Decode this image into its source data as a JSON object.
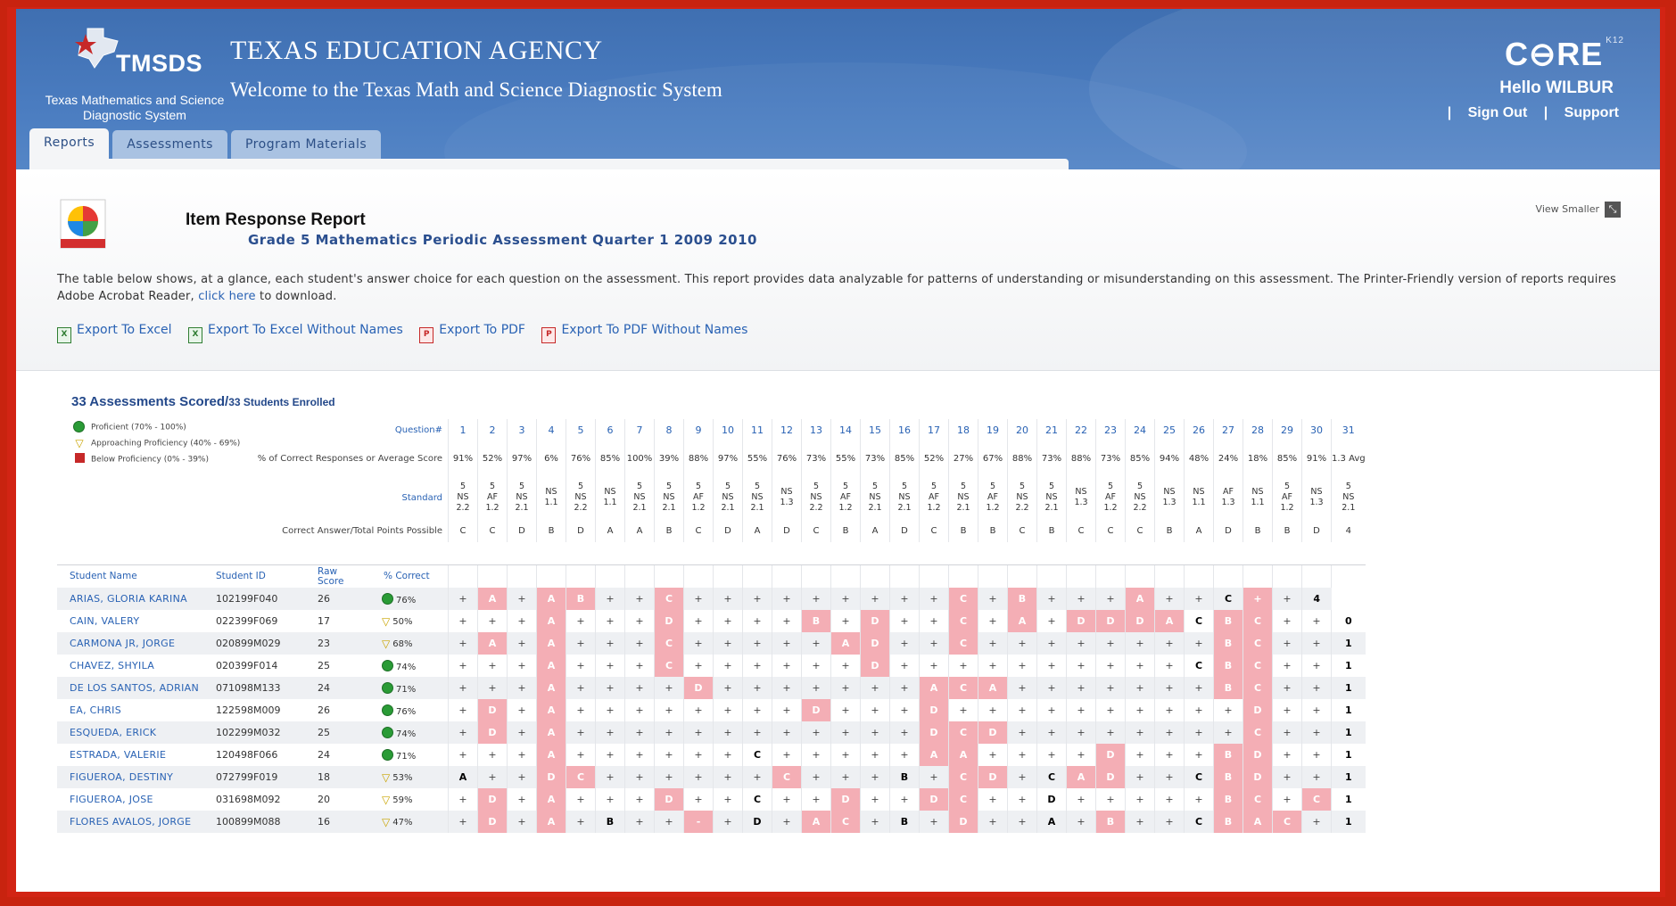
{
  "header": {
    "logo_text": "TMSDS",
    "logo_subtitle": "Texas Mathematics and Science Diagnostic System",
    "agency": "TEXAS EDUCATION AGENCY",
    "welcome": "Welcome to the Texas Math and Science Diagnostic System",
    "brand": "C⊖RE",
    "brand_sup": "K12",
    "hello": "Hello WILBUR",
    "sign_out": "Sign Out",
    "support": "Support",
    "sep": "|"
  },
  "tabs": [
    "Reports",
    "Assessments",
    "Program Materials"
  ],
  "report": {
    "title": "Item Response Report",
    "subtitle": "Grade 5 Mathematics Periodic Assessment Quarter 1 2009 2010",
    "view_smaller": "View Smaller",
    "desc_before": "The table below shows, at a glance, each student's answer choice for each question on the assessment. This report provides data analyzable for patterns of understanding or misunderstanding on this assessment. The Printer-Friendly version of reports requires Adobe Acrobat Reader, ",
    "desc_link": "click here",
    "desc_after": " to download."
  },
  "exports": [
    "Export To Excel",
    "Export To Excel Without Names",
    "Export To PDF",
    "Export To PDF Without Names"
  ],
  "summary": {
    "scored": "33 Assessments Scored/",
    "enrolled": "33 Students Enrolled"
  },
  "legend": [
    {
      "label": "Proficient  (70% - 100%)",
      "color": "#2a9b36"
    },
    {
      "label": "Approaching Proficiency  (40% - 69%)",
      "color": "#c9a400"
    },
    {
      "label": "Below Proficiency  (0% - 39%)",
      "color": "#c62828"
    }
  ],
  "row_labels": {
    "question": "Question#",
    "pct_correct": "% of Correct Responses or Average Score",
    "standard": "Standard",
    "answer": "Correct Answer/Total Points Possible"
  },
  "columns": {
    "student_name": "Student Name",
    "student_id": "Student ID",
    "raw_score": "Raw Score",
    "pct_correct": "% Correct"
  },
  "questions": [
    "1",
    "2",
    "3",
    "4",
    "5",
    "6",
    "7",
    "8",
    "9",
    "10",
    "11",
    "12",
    "13",
    "14",
    "15",
    "16",
    "17",
    "18",
    "19",
    "20",
    "21",
    "22",
    "23",
    "24",
    "25",
    "26",
    "27",
    "28",
    "29",
    "30",
    "31"
  ],
  "pct": [
    "91%",
    "52%",
    "97%",
    "6%",
    "76%",
    "85%",
    "100%",
    "39%",
    "88%",
    "97%",
    "55%",
    "76%",
    "73%",
    "55%",
    "73%",
    "85%",
    "52%",
    "27%",
    "67%",
    "88%",
    "73%",
    "88%",
    "73%",
    "85%",
    "94%",
    "48%",
    "24%",
    "18%",
    "85%",
    "91%",
    "1.3 Avg"
  ],
  "standards": [
    "5 NS 2.2",
    "5 AF 1.2",
    "5 NS 2.1",
    "NS 1.1",
    "5 NS 2.2",
    "NS 1.1",
    "5 NS 2.1",
    "5 NS 2.1",
    "5 AF 1.2",
    "5 NS 2.1",
    "5 NS 2.1",
    "NS 1.3",
    "5 NS 2.2",
    "5 AF 1.2",
    "5 NS 2.1",
    "5 NS 2.1",
    "5 AF 1.2",
    "5 NS 2.1",
    "5 AF 1.2",
    "5 NS 2.2",
    "5 NS 2.1",
    "NS 1.3",
    "5 AF 1.2",
    "5 NS 2.2",
    "NS 1.3",
    "NS 1.1",
    "AF 1.3",
    "NS 1.1",
    "5 AF 1.2",
    "NS 1.3",
    "5 NS 2.1"
  ],
  "answers": [
    "C",
    "C",
    "D",
    "B",
    "D",
    "A",
    "A",
    "B",
    "C",
    "D",
    "A",
    "D",
    "C",
    "B",
    "A",
    "D",
    "C",
    "B",
    "B",
    "C",
    "B",
    "C",
    "C",
    "C",
    "B",
    "A",
    "D",
    "B",
    "B",
    "D",
    "4"
  ],
  "students": [
    {
      "name": "ARIAS, GLORIA KARINA",
      "id": "102199F040",
      "raw": "26",
      "pct": "76%",
      "level": "p",
      "r": [
        "+",
        "A",
        "+",
        "A",
        "B",
        "+",
        "+",
        "C",
        "+",
        "+",
        "+",
        "+",
        "+",
        "+",
        "+",
        "+",
        "+",
        "C",
        "+",
        "B",
        "+",
        "+",
        "+",
        "A",
        "+",
        "+",
        "C",
        "+",
        "+",
        "4"
      ],
      "w": [
        1,
        3,
        4,
        7,
        17,
        19,
        23,
        27
      ]
    },
    {
      "name": "CAIN, VALERY",
      "id": "022399F069",
      "raw": "17",
      "pct": "50%",
      "level": "a",
      "r": [
        "+",
        "+",
        "+",
        "A",
        "+",
        "+",
        "+",
        "D",
        "+",
        "+",
        "+",
        "+",
        "B",
        "+",
        "D",
        "+",
        "+",
        "C",
        "+",
        "A",
        "+",
        "D",
        "D",
        "D",
        "A",
        "C",
        "B",
        "C",
        "+",
        "+",
        "0"
      ],
      "w": [
        3,
        7,
        12,
        14,
        17,
        19,
        21,
        22,
        23,
        24,
        26,
        27
      ]
    },
    {
      "name": "CARMONA JR, JORGE",
      "id": "020899M029",
      "raw": "23",
      "pct": "68%",
      "level": "a",
      "r": [
        "+",
        "A",
        "+",
        "A",
        "+",
        "+",
        "+",
        "C",
        "+",
        "+",
        "+",
        "+",
        "+",
        "A",
        "D",
        "+",
        "+",
        "C",
        "+",
        "+",
        "+",
        "+",
        "+",
        "+",
        "+",
        "+",
        "B",
        "C",
        "+",
        "+",
        "1"
      ],
      "w": [
        1,
        3,
        7,
        13,
        14,
        17,
        26,
        27
      ]
    },
    {
      "name": "CHAVEZ, SHYILA",
      "id": "020399F014",
      "raw": "25",
      "pct": "74%",
      "level": "p",
      "r": [
        "+",
        "+",
        "+",
        "A",
        "+",
        "+",
        "+",
        "C",
        "+",
        "+",
        "+",
        "+",
        "+",
        "+",
        "D",
        "+",
        "+",
        "+",
        "+",
        "+",
        "+",
        "+",
        "+",
        "+",
        "+",
        "C",
        "B",
        "C",
        "+",
        "+",
        "1"
      ],
      "w": [
        3,
        7,
        14,
        26,
        27
      ]
    },
    {
      "name": "DE LOS SANTOS, ADRIAN",
      "id": "071098M133",
      "raw": "24",
      "pct": "71%",
      "level": "p",
      "r": [
        "+",
        "+",
        "+",
        "A",
        "+",
        "+",
        "+",
        "+",
        "D",
        "+",
        "+",
        "+",
        "+",
        "+",
        "+",
        "+",
        "A",
        "C",
        "A",
        "+",
        "+",
        "+",
        "+",
        "+",
        "+",
        "+",
        "B",
        "C",
        "+",
        "+",
        "1"
      ],
      "w": [
        3,
        8,
        16,
        17,
        18,
        26,
        27
      ]
    },
    {
      "name": "EA, CHRIS",
      "id": "122598M009",
      "raw": "26",
      "pct": "76%",
      "level": "p",
      "r": [
        "+",
        "D",
        "+",
        "A",
        "+",
        "+",
        "+",
        "+",
        "+",
        "+",
        "+",
        "+",
        "D",
        "+",
        "+",
        "+",
        "D",
        "+",
        "+",
        "+",
        "+",
        "+",
        "+",
        "+",
        "+",
        "+",
        "+",
        "D",
        "+",
        "+",
        "1"
      ],
      "w": [
        1,
        3,
        12,
        16,
        27
      ]
    },
    {
      "name": "ESQUEDA, ERICK",
      "id": "102299M032",
      "raw": "25",
      "pct": "74%",
      "level": "p",
      "r": [
        "+",
        "D",
        "+",
        "A",
        "+",
        "+",
        "+",
        "+",
        "+",
        "+",
        "+",
        "+",
        "+",
        "+",
        "+",
        "+",
        "D",
        "C",
        "D",
        "+",
        "+",
        "+",
        "+",
        "+",
        "+",
        "+",
        "+",
        "C",
        "+",
        "+",
        "1"
      ],
      "w": [
        1,
        3,
        16,
        17,
        18,
        27
      ]
    },
    {
      "name": "ESTRADA, VALERIE",
      "id": "120498F066",
      "raw": "24",
      "pct": "71%",
      "level": "p",
      "r": [
        "+",
        "+",
        "+",
        "A",
        "+",
        "+",
        "+",
        "+",
        "+",
        "+",
        "C",
        "+",
        "+",
        "+",
        "+",
        "+",
        "A",
        "A",
        "+",
        "+",
        "+",
        "+",
        "D",
        "+",
        "+",
        "+",
        "B",
        "D",
        "+",
        "+",
        "1"
      ],
      "w": [
        3,
        16,
        17,
        22,
        26,
        27
      ]
    },
    {
      "name": "FIGUEROA, DESTINY",
      "id": "072799F019",
      "raw": "18",
      "pct": "53%",
      "level": "a",
      "r": [
        "A",
        "+",
        "+",
        "D",
        "C",
        "+",
        "+",
        "+",
        "+",
        "+",
        "+",
        "C",
        "+",
        "+",
        "+",
        "B",
        "+",
        "C",
        "D",
        "+",
        "C",
        "A",
        "D",
        "+",
        "+",
        "C",
        "B",
        "D",
        "+",
        "+",
        "1"
      ],
      "w": [
        3,
        4,
        11,
        17,
        18,
        21,
        22,
        26,
        27
      ]
    },
    {
      "name": "FIGUEROA, JOSE",
      "id": "031698M092",
      "raw": "20",
      "pct": "59%",
      "level": "a",
      "r": [
        "+",
        "D",
        "+",
        "A",
        "+",
        "+",
        "+",
        "D",
        "+",
        "+",
        "C",
        "+",
        "+",
        "D",
        "+",
        "+",
        "D",
        "C",
        "+",
        "+",
        "D",
        "+",
        "+",
        "+",
        "+",
        "+",
        "B",
        "C",
        "+",
        "C",
        "1"
      ],
      "w": [
        1,
        3,
        7,
        13,
        16,
        17,
        26,
        27,
        29
      ]
    },
    {
      "name": "FLORES AVALOS, JORGE",
      "id": "100899M088",
      "raw": "16",
      "pct": "47%",
      "level": "a",
      "r": [
        "+",
        "D",
        "+",
        "A",
        "+",
        "B",
        "+",
        "+",
        "-",
        "+",
        "D",
        "+",
        "A",
        "C",
        "+",
        "B",
        "+",
        "D",
        "+",
        "+",
        "A",
        "+",
        "B",
        "+",
        "+",
        "C",
        "B",
        "A",
        "C",
        "+",
        "1"
      ],
      "w": [
        1,
        3,
        8,
        12,
        13,
        17,
        22,
        26,
        27,
        28
      ]
    }
  ]
}
